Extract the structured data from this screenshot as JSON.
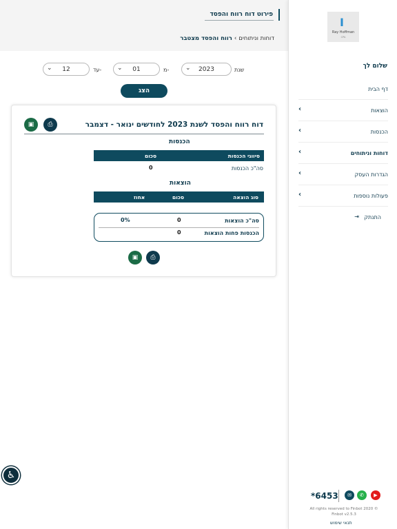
{
  "header": {
    "title": "פירוט דוח רווח והפסד",
    "breadcrumb": {
      "parent": "דוחות וניתוחים",
      "separator": "›",
      "current": "רווח והפסד מצטבר"
    }
  },
  "filters": {
    "year_label": "שנת",
    "year_value": "2023",
    "from_label": "מ-",
    "from_value": "01",
    "to_label": "עד-",
    "to_value": "12",
    "show_button": "הצג"
  },
  "report": {
    "title": "דוח רווח והפסד לשנת 2023 לחודשים ינואר - דצמבר",
    "income": {
      "section_title": "הכנסות",
      "col_type": "סיווגי הכנסות",
      "col_amount": "סכום",
      "total_label": "סה\"כ הכנסות",
      "total_value": "0"
    },
    "expenses": {
      "section_title": "הוצאות",
      "col_type": "סוג הוצאה",
      "col_amount": "סכום",
      "col_percent": "אחוז"
    },
    "summary": {
      "total_expenses_label": "סה\"כ הוצאות",
      "total_expenses_value": "0",
      "total_expenses_percent": "0%",
      "net_label": "הכנסות פחות הוצאות",
      "net_value": "0"
    }
  },
  "sidebar": {
    "logo_text": "Ray Hoffman",
    "logo_sub": "CPA",
    "greeting": "שלום לך",
    "items": [
      {
        "label": "דף הבית",
        "has_chevron": false
      },
      {
        "label": "הוצאות",
        "has_chevron": true
      },
      {
        "label": "הכנסות",
        "has_chevron": true
      },
      {
        "label": "דוחות וניתוחים",
        "has_chevron": true,
        "active": true
      },
      {
        "label": "הגדרות העסק",
        "has_chevron": true
      },
      {
        "label": "פעולות נוספות",
        "has_chevron": true
      }
    ],
    "logout_label": "התנתק",
    "phone": "*6453",
    "footer_line1": "All rights reserved to Finbot 2020 ©",
    "footer_line2": "Finbot v2.5.3",
    "terms": "תנאי שימוש"
  },
  "colors": {
    "primary": "#0e4a5e",
    "excel": "#1b6b46",
    "whatsapp": "#25b04a",
    "youtube": "#e21c1c"
  },
  "icons": [
    "excel-icon",
    "print-icon",
    "chevron-left-icon",
    "logout-icon",
    "email-icon",
    "whatsapp-icon",
    "youtube-icon",
    "accessibility-icon"
  ]
}
